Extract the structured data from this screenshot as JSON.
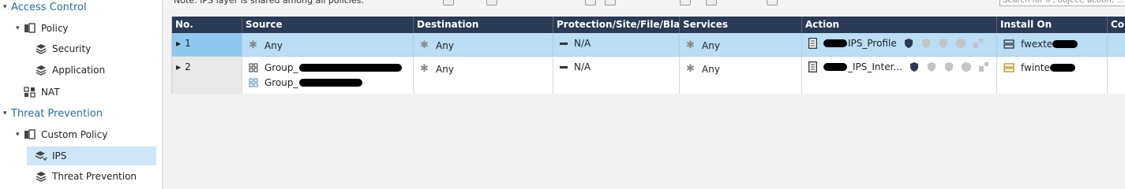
{
  "sidebar": {
    "access_control": "Access Control",
    "policy": "Policy",
    "security": "Security",
    "application": "Application",
    "nat": "NAT",
    "threat_prevention": "Threat Prevention",
    "custom_policy": "Custom Policy",
    "ips": "IPS",
    "threat_prevention_item": "Threat Prevention"
  },
  "toolbar": {
    "info_text": "Note: IPS layer is shared among all policies.",
    "search_placeholder": "Search for IP, object, action, ..."
  },
  "table": {
    "columns": [
      "No.",
      "Source",
      "Destination",
      "Protection/Site/File/Blade",
      "Services",
      "Action",
      "Install On",
      "Com"
    ],
    "rows": [
      {
        "no": "1",
        "source": [
          "Any"
        ],
        "destination": "Any",
        "protection": "N/A",
        "services": "Any",
        "action": "IPS_Profile",
        "install_on": "fwexte"
      },
      {
        "no": "2",
        "source": [
          "Group_",
          "Group_"
        ],
        "destination": "Any",
        "protection": "N/A",
        "services": "Any",
        "action": "_IPS_Inter...",
        "install_on": "fwinte"
      }
    ]
  },
  "colors": {
    "header_bg": "#2b3a55",
    "selected_row": "#b9def5",
    "section_text": "#2a6ea8"
  }
}
